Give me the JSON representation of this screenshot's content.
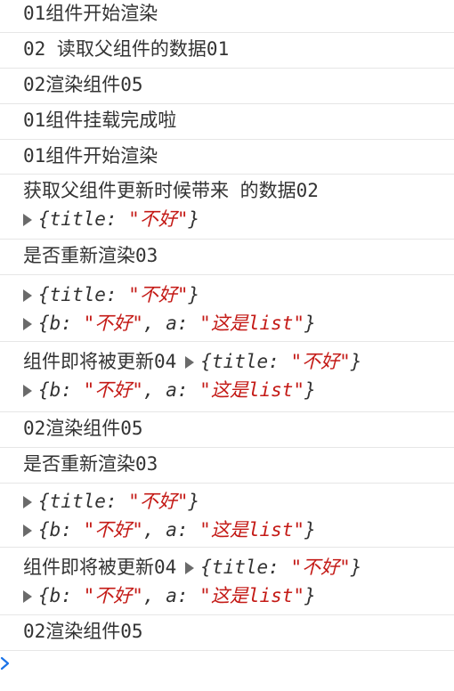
{
  "log": {
    "r1": "01组件开始渲染",
    "r2": "02 读取父组件的数据01",
    "r3": "02渲染组件05",
    "r4": "01组件挂载完成啦",
    "r5": "01组件开始渲染",
    "r6": "获取父组件更新时候带来 的数据02",
    "r7": "是否重新渲染03",
    "r9": "组件即将被更新04",
    "r10": "02渲染组件05",
    "r11": "是否重新渲染03",
    "r13": "组件即将被更新04",
    "r14": "02渲染组件05"
  },
  "obj": {
    "title_key": "title",
    "title_val": "不好",
    "b_key": "b",
    "b_val": "不好",
    "a_key": "a",
    "a_val": "这是list"
  },
  "colors": {
    "string": "#c41a16",
    "text": "#333333",
    "prompt": "#1a73e8"
  },
  "icons": [
    "expand-triangle-icon",
    "console-prompt-icon"
  ]
}
